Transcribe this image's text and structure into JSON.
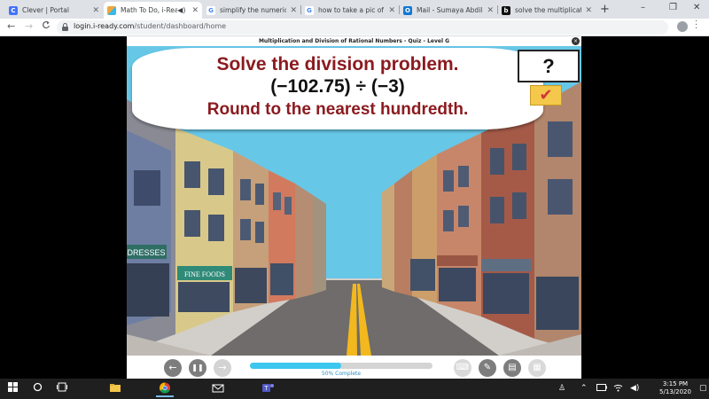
{
  "browser": {
    "tabs": [
      {
        "title": "Clever | Portal",
        "favicon": "clever-icon",
        "color": "#4274f6",
        "glyph": "C",
        "active": false
      },
      {
        "title": "Math To Do, i-Ready",
        "favicon": "iready-icon",
        "color": "#f0a63c",
        "glyph": "",
        "active": true,
        "audio": true
      },
      {
        "title": "simplify the numerical e",
        "favicon": "google-icon",
        "color": "#ffffff",
        "glyph": "G",
        "active": false
      },
      {
        "title": "how to take a pic of you",
        "favicon": "google-icon",
        "color": "#ffffff",
        "glyph": "G",
        "active": false
      },
      {
        "title": "Mail - Sumaya Abdille -",
        "favicon": "outlook-icon",
        "color": "#0f78d4",
        "glyph": "O",
        "active": false
      },
      {
        "title": "solve the multiplication",
        "favicon": "brainly-icon",
        "color": "#111111",
        "glyph": "b",
        "active": false
      }
    ],
    "new_tab": "+",
    "window_controls": {
      "minimize": "–",
      "maximize": "❐",
      "close": "✕"
    },
    "nav": {
      "back": "←",
      "forward": "→",
      "reload": "C"
    },
    "url_host": "login.i-ready.com",
    "url_path": "/student/dashboard/home",
    "star": "★"
  },
  "lesson": {
    "title": "Multiplication and Division of Rational Numbers - Quiz - Level G",
    "close": "×",
    "problem_line1": "Solve the division problem.",
    "problem_line2": "(−102.75) ÷ (−3)",
    "problem_line3": "Round to the nearest hundredth.",
    "answer_placeholder": "?",
    "check_mark": "✔"
  },
  "controls": {
    "back": "←",
    "pause": "❚❚",
    "forward": "→",
    "progress": 0.5,
    "progress_label": "50% Complete",
    "tools": [
      {
        "name": "keyboard-tool",
        "glyph": "⌨",
        "enabled": false
      },
      {
        "name": "pencil-tool",
        "glyph": "✎",
        "enabled": true
      },
      {
        "name": "notepad-tool",
        "glyph": "▤",
        "enabled": true
      },
      {
        "name": "calculator-tool",
        "glyph": "▦",
        "enabled": false
      }
    ]
  },
  "taskbar": {
    "time": "3:15 PM",
    "date": "5/13/2020"
  },
  "colors": {
    "problem_red": "#8b1a1f",
    "progress_blue": "#3cc7ee",
    "sky": "#5fc3e6"
  }
}
